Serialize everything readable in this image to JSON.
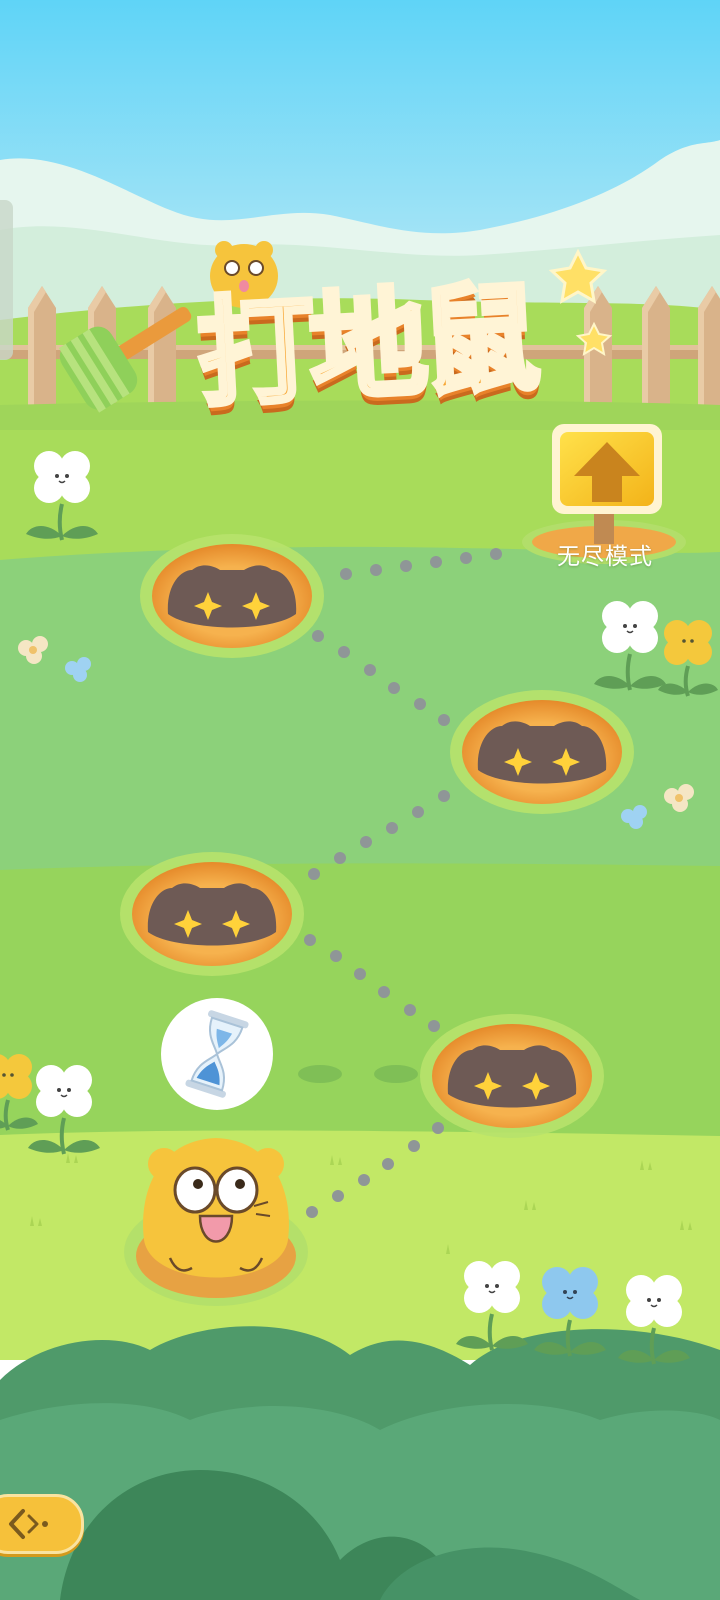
{
  "game": {
    "title": "打地鼠",
    "endless_mode_label": "无尽模式"
  },
  "colors": {
    "sky_top": "#5fd4f7",
    "grass_light": "#a8dc5a",
    "grass_mid": "#8cd17a",
    "hole_rim": "#f0a848",
    "hole_inside": "#6e5a55",
    "sparkle": "#ffd23a",
    "accent_yellow": "#f6c13a"
  },
  "icons": {
    "timer": "hourglass-icon",
    "back": "back-arrow-icon",
    "endless": "up-arrow-icon"
  }
}
